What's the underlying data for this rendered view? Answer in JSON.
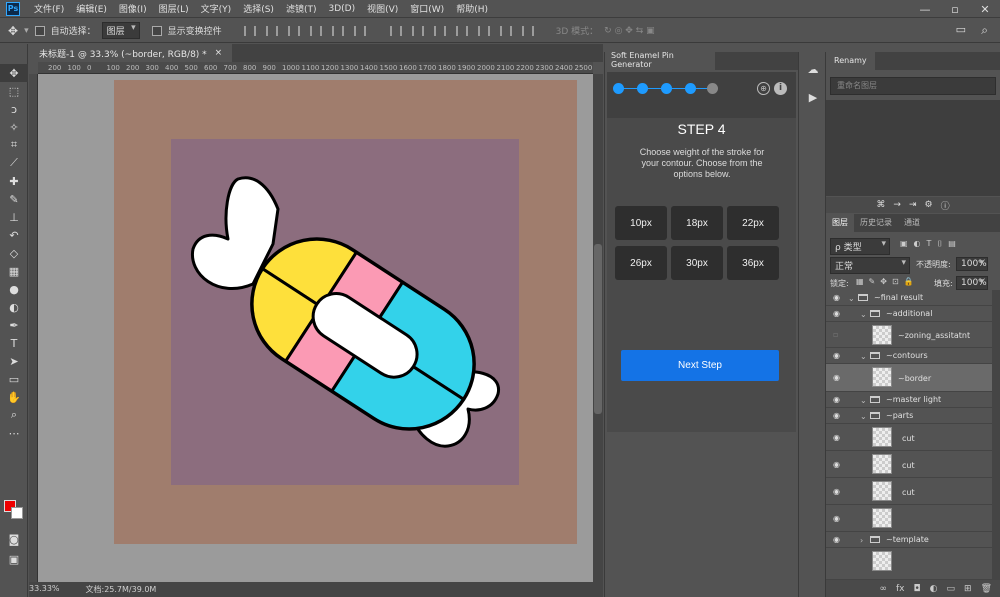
{
  "menubar": {
    "logo": "Ps",
    "items": [
      "文件(F)",
      "编辑(E)",
      "图像(I)",
      "图层(L)",
      "文字(Y)",
      "选择(S)",
      "滤镜(T)",
      "3D(D)",
      "视图(V)",
      "窗口(W)",
      "帮助(H)"
    ]
  },
  "options": {
    "auto_select_label": "自动选择：",
    "auto_select_value": "图层",
    "show_transform_label": "显示变换控件",
    "mode_3d_label": "3D 模式："
  },
  "document": {
    "tab_title": "未标题-1 @ 33.3% (~border, RGB/8) *",
    "close": "×",
    "ruler_ticks": [
      "200",
      "100",
      "0",
      "100",
      "200",
      "300",
      "400",
      "500",
      "600",
      "700",
      "800",
      "900",
      "1000",
      "1100",
      "1200",
      "1300",
      "1400",
      "1500",
      "1600",
      "1700",
      "1800",
      "1900",
      "2000",
      "2100",
      "2200",
      "2300",
      "2400",
      "2500"
    ],
    "zoom": "33.33%",
    "doc_size": "文档:25.7M/39.0M"
  },
  "plugin": {
    "tab_title": "Soft Enamel Pin Generator",
    "step_title": "STEP 4",
    "step_desc": "Choose weight of the stroke for your contour. Choose from the options below.",
    "options": [
      "10px",
      "18px",
      "22px",
      "26px",
      "30px",
      "36px"
    ],
    "next_label": "Next Step",
    "steps_total": 5,
    "steps_active": 4,
    "accent": "#1e9bff"
  },
  "renamy": {
    "tab_title": "Renamy",
    "search_placeholder": "重命名图层"
  },
  "layers": {
    "tabs": [
      "图层",
      "历史记录",
      "通道"
    ],
    "filter_label": "ρ 类型",
    "blend_mode": "正常",
    "opacity_label": "不透明度:",
    "opacity_value": "100%",
    "lock_label": "锁定:",
    "fill_label": "填充:",
    "fill_value": "100%",
    "items": [
      {
        "name": "~final result",
        "kind": "group"
      },
      {
        "name": "~additional",
        "kind": "group"
      },
      {
        "name": "~zoning_assitatnt",
        "kind": "layer"
      },
      {
        "name": "~contours",
        "kind": "group"
      },
      {
        "name": "~border",
        "kind": "layer"
      },
      {
        "name": "~master light",
        "kind": "group"
      },
      {
        "name": "~parts",
        "kind": "group"
      },
      {
        "name": "cut",
        "kind": "layer"
      },
      {
        "name": "cut",
        "kind": "layer"
      },
      {
        "name": "cut",
        "kind": "layer"
      },
      {
        "name": "~template",
        "kind": "group"
      }
    ]
  },
  "colors": {
    "foreground": "#ee0000",
    "background": "#ffffff",
    "candy_yellow": "#fee03b",
    "candy_pink": "#fb9ab4",
    "candy_cyan": "#33d2ea"
  }
}
